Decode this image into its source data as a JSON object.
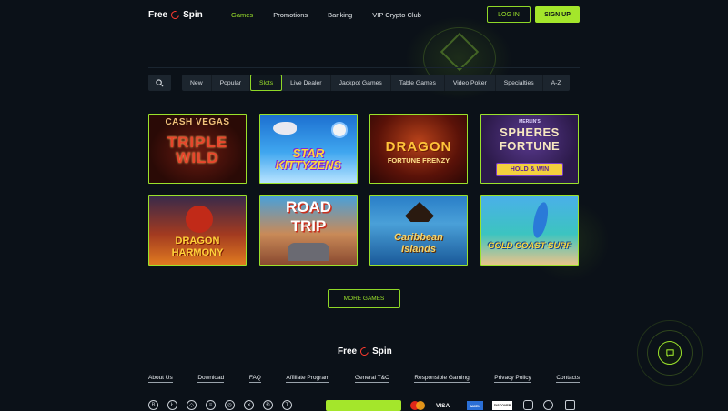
{
  "brand": {
    "word1": "Free",
    "word2": "Spin"
  },
  "nav": [
    {
      "label": "Games",
      "active": true
    },
    {
      "label": "Promotions"
    },
    {
      "label": "Banking"
    },
    {
      "label": "VIP Crypto Club"
    }
  ],
  "auth": {
    "login": "LOG IN",
    "signup": "SIGN UP"
  },
  "filters": {
    "search_icon": "search-icon",
    "tabs": [
      "New",
      "Popular",
      "Slots",
      "Live Dealer",
      "Jackpot Games",
      "Table Games",
      "Video Poker",
      "Specialties",
      "A-Z"
    ],
    "active_tab": "Slots"
  },
  "games": [
    {
      "line1": "CASH VEGAS",
      "line2": "TRIPLE WILD"
    },
    {
      "line1": "STAR KITTYZENS"
    },
    {
      "line1": "DRAGON",
      "line2": "FORTUNE FRENZY"
    },
    {
      "line0": "MERLIN'S",
      "line1": "SPHERES",
      "line2": "FORTUNE",
      "badge": "HOLD & WIN"
    },
    {
      "line1": "DRAGON",
      "line2": "HARMONY"
    },
    {
      "line1": "ROAD",
      "line2": "TRIP"
    },
    {
      "line1": "Caribbean",
      "line2": "Islands"
    },
    {
      "line1": "GOLD COAST SURF"
    }
  ],
  "more_games": "MORE GAMES",
  "footer": {
    "links": [
      "About Us",
      "Download",
      "FAQ",
      "Affiliate Program",
      "General T&C",
      "Responsible Gaming",
      "Privacy Policy",
      "Contacts"
    ],
    "crypto": [
      "B",
      "Ł",
      "◇",
      "≡",
      "◎",
      "✕",
      "Đ",
      "T"
    ],
    "payments": [
      "VISA",
      "AMEX",
      "DISCOVER"
    ]
  },
  "colors": {
    "accent": "#9be22b",
    "background": "#0b1118",
    "tab_bg": "#1c252e"
  }
}
